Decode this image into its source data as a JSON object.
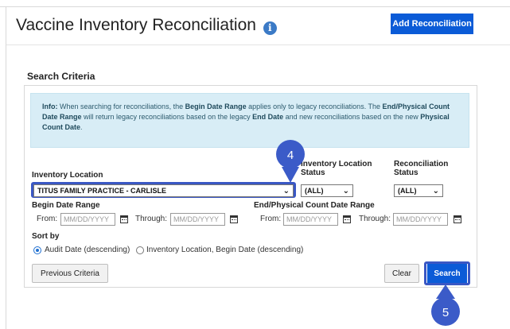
{
  "header": {
    "title": "Vaccine Inventory Reconciliation",
    "info_glyph": "i",
    "add_button": "Add Reconciliation"
  },
  "search": {
    "section_title": "Search Criteria",
    "info": {
      "prefix": "Info:",
      "t1": " When searching for reconciliations, the ",
      "b1": "Begin Date Range",
      "t2": " applies only to legacy reconciliations. The ",
      "b2": "End/Physical Count Date Range",
      "t3": " will return legacy reconciliations based on the legacy ",
      "b3": "End Date",
      "t4": " and new reconciliations based on the new ",
      "b4": "Physical Count Date",
      "t5": "."
    },
    "inventory_location": {
      "label": "Inventory Location",
      "value": "TITUS FAMILY PRACTICE - CARLISLE"
    },
    "inventory_location_status": {
      "label_line1": "Inventory Location",
      "label_line2": "Status",
      "value": "(ALL)"
    },
    "reconciliation_status": {
      "label_line1": "Reconciliation",
      "label_line2": "Status",
      "value": "(ALL)"
    },
    "begin_date_range": {
      "label": "Begin Date Range",
      "from_label": "From:",
      "through_label": "Through:",
      "from_placeholder": "MM/DD/YYYY",
      "through_placeholder": "MM/DD/YYYY"
    },
    "end_date_range": {
      "label": "End/Physical Count Date Range",
      "from_label": "From:",
      "through_label": "Through:",
      "from_placeholder": "MM/DD/YYYY",
      "through_placeholder": "MM/DD/YYYY"
    },
    "sort": {
      "label": "Sort by",
      "options": [
        "Audit Date (descending)",
        "Inventory Location, Begin Date (descending)"
      ],
      "selected_index": 0
    },
    "buttons": {
      "previous": "Previous Criteria",
      "clear": "Clear",
      "search": "Search"
    }
  },
  "markers": {
    "step4": "4",
    "step5": "5"
  },
  "colors": {
    "primary": "#0b5bd7",
    "marker": "#3b5bc8",
    "info_bg": "#d8edf6"
  }
}
